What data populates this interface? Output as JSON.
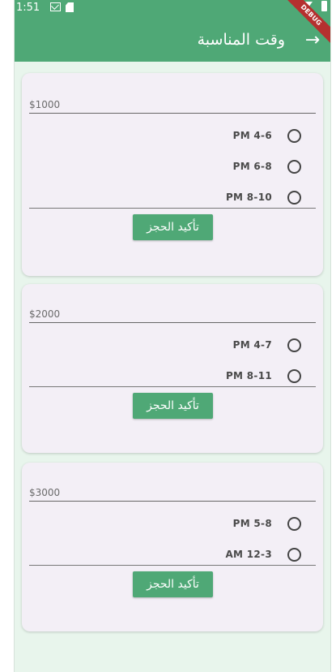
{
  "status_bar": {
    "time": "1:51"
  },
  "debug_banner": "DEBUG",
  "appbar": {
    "title": "وقت المناسبة",
    "back_icon": "arrow-right-icon"
  },
  "cards": [
    {
      "price": "$1000",
      "slots": [
        {
          "label": "PM 4-6",
          "selected": false
        },
        {
          "label": "PM 6-8",
          "selected": false
        },
        {
          "label": "PM 8-10",
          "selected": false
        }
      ],
      "button_label": "تأكيد الحجز"
    },
    {
      "price": "$2000",
      "slots": [
        {
          "label": "PM 4-7",
          "selected": false
        },
        {
          "label": "PM 8-11",
          "selected": false
        }
      ],
      "button_label": "تأكيد الحجز"
    },
    {
      "price": "$3000",
      "slots": [
        {
          "label": "PM 5-8",
          "selected": false
        },
        {
          "label": "AM 12-3",
          "selected": false
        }
      ],
      "button_label": "تأكيد الحجز"
    }
  ],
  "colors": {
    "primary": "#4fa876",
    "background": "#e8f5ec",
    "card": "#f3eff6",
    "debug": "#b5302f"
  }
}
